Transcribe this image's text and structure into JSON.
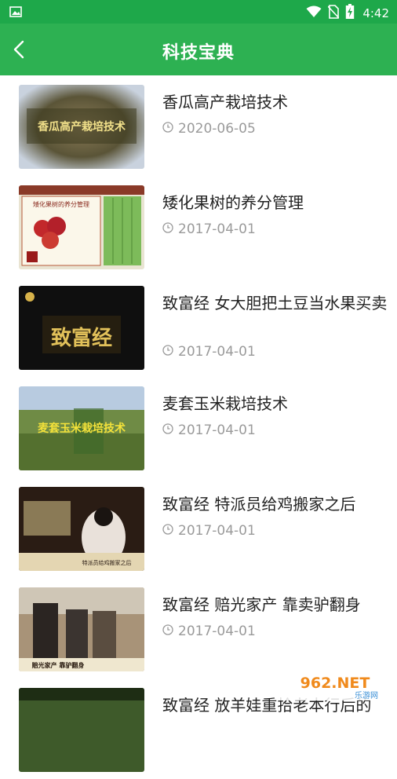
{
  "status_bar": {
    "time": "4:42"
  },
  "app_bar": {
    "title": "科技宝典"
  },
  "items": [
    {
      "title": "香瓜高产栽培技术",
      "date": "2020-06-05",
      "thumb_caption": "香瓜高产栽培技术"
    },
    {
      "title": "矮化果树的养分管理",
      "date": "2017-04-01",
      "thumb_caption": "矮化果树的养分管理"
    },
    {
      "title": "致富经 女大胆把土豆当水果买卖",
      "date": "2017-04-01",
      "thumb_caption": "致富经"
    },
    {
      "title": "麦套玉米栽培技术",
      "date": "2017-04-01",
      "thumb_caption": "麦套玉米栽培技术"
    },
    {
      "title": "致富经 特派员给鸡搬家之后",
      "date": "2017-04-01",
      "thumb_caption": "特派员给鸡搬家之后"
    },
    {
      "title": "致富经 赔光家产 靠卖驴翻身",
      "date": "2017-04-01",
      "thumb_caption": "赔光家产 靠驴翻身"
    },
    {
      "title": "致富经 放羊娃重拾老本行后的",
      "date": "",
      "thumb_caption": ""
    }
  ],
  "watermark": {
    "text": "962.NET",
    "subtext": "乐游网"
  },
  "colors": {
    "appbar": "#2db152",
    "statusbar": "#1ea84a",
    "text": "#222222",
    "date": "#9a9a9a"
  }
}
